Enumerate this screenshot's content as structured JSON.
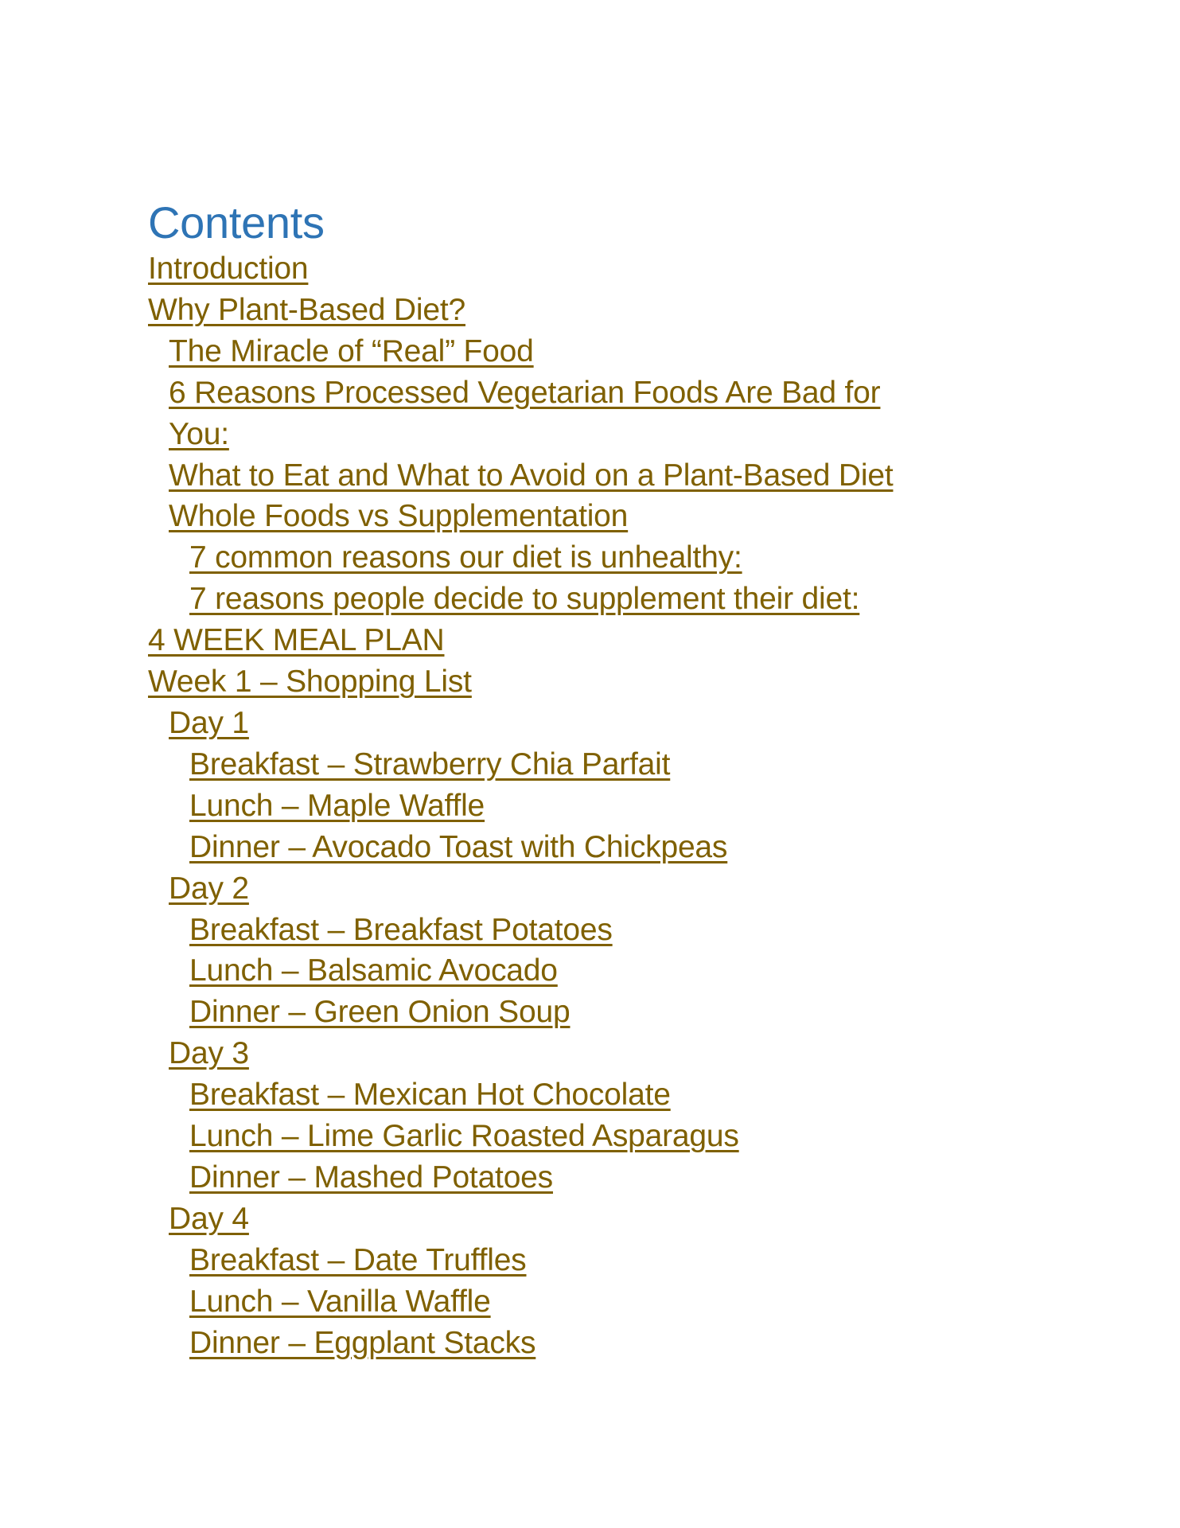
{
  "toc": {
    "title": "Contents",
    "colors": {
      "title": "#2e74b5",
      "link": "#7f6000"
    },
    "items": [
      {
        "level": 0,
        "label": "Introduction"
      },
      {
        "level": 0,
        "label": "Why Plant-Based Diet?"
      },
      {
        "level": 1,
        "label": "The Miracle of “Real” Food"
      },
      {
        "level": 1,
        "label": "6 Reasons Processed Vegetarian Foods Are Bad for",
        "continuation": "You:"
      },
      {
        "level": 1,
        "label": "What to Eat and What to Avoid on a Plant-Based Diet"
      },
      {
        "level": 1,
        "label": "Whole Foods vs Supplementation"
      },
      {
        "level": 2,
        "label": "7 common reasons our diet is unhealthy:"
      },
      {
        "level": 2,
        "label": "7 reasons people decide to supplement their diet:"
      },
      {
        "level": 0,
        "label": "4 WEEK MEAL PLAN"
      },
      {
        "level": 0,
        "label": "Week 1 – Shopping List"
      },
      {
        "level": 1,
        "label": "Day 1"
      },
      {
        "level": 2,
        "label": "Breakfast – Strawberry Chia Parfait"
      },
      {
        "level": 2,
        "label": "Lunch – Maple Waffle"
      },
      {
        "level": 2,
        "label": "Dinner – Avocado Toast with Chickpeas"
      },
      {
        "level": 1,
        "label": "Day 2"
      },
      {
        "level": 2,
        "label": "Breakfast – Breakfast Potatoes"
      },
      {
        "level": 2,
        "label": "Lunch – Balsamic Avocado"
      },
      {
        "level": 2,
        "label": "Dinner – Green Onion Soup"
      },
      {
        "level": 1,
        "label": "Day 3"
      },
      {
        "level": 2,
        "label": "Breakfast – Mexican Hot Chocolate"
      },
      {
        "level": 2,
        "label": "Lunch – Lime Garlic Roasted Asparagus"
      },
      {
        "level": 2,
        "label": "Dinner – Mashed Potatoes"
      },
      {
        "level": 1,
        "label": "Day 4"
      },
      {
        "level": 2,
        "label": "Breakfast – Date Truffles"
      },
      {
        "level": 2,
        "label": "Lunch – Vanilla Waffle"
      },
      {
        "level": 2,
        "label": "Dinner – Eggplant Stacks"
      }
    ]
  }
}
